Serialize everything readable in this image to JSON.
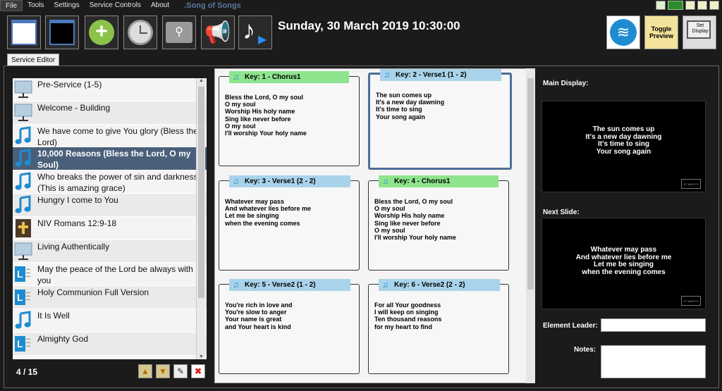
{
  "menu": {
    "items": [
      "File",
      "Tools",
      "Settings",
      "Service Controls",
      "About"
    ],
    "app_title": ".Song of Songs"
  },
  "toolbar": {
    "datetime": "Sunday, 30 March 2019 10:30:00",
    "toggle_preview_label": "Toggle Preview",
    "set_display_label": "Set Display"
  },
  "tab": {
    "label": "Service Editor"
  },
  "service_list": {
    "counter": "4 / 15",
    "items": [
      {
        "label": "Pre-Service (1-5)",
        "icon": "monitor-icon"
      },
      {
        "label": "Welcome - Building",
        "icon": "monitor-icon"
      },
      {
        "label": "We have come to give You glory  (Bless the Lord)",
        "icon": "music-note-icon"
      },
      {
        "label": "10,000 Reasons (Bless the Lord, O my Soul)",
        "icon": "music-note-icon",
        "selected": true
      },
      {
        "label": "Who breaks the power of sin and darkness (This is amazing grace)",
        "icon": "music-note-icon"
      },
      {
        "label": "Hungry I come to You",
        "icon": "music-note-icon"
      },
      {
        "label": "NIV Romans 12:9-18",
        "icon": "bible-icon"
      },
      {
        "label": "Living Authentically",
        "icon": "monitor-icon"
      },
      {
        "label": "May the peace of the Lord be always with you",
        "icon": "liturgy-icon"
      },
      {
        "label": "Holy Communion Full Version",
        "icon": "liturgy-icon"
      },
      {
        "label": "It Is Well",
        "icon": "music-note-icon"
      },
      {
        "label": "Almighty God",
        "icon": "liturgy-icon"
      }
    ]
  },
  "slides": [
    {
      "key": "Key: 1 - Chorus1",
      "type": "chorus",
      "lyrics": "Bless the Lord, O my soul\nO my soul\nWorship His holy name\nSing like never before\nO my soul\nI'll worship Your holy name"
    },
    {
      "key": "Key: 2 - Verse1 (1 - 2)",
      "type": "verse",
      "current": true,
      "lyrics": "The sun comes up\nIt's a new day dawning\nIt's time to sing\nYour song again"
    },
    {
      "key": "Key: 3 - Verse1 (2 - 2)",
      "type": "verse",
      "lyrics": "Whatever may pass\nAnd whatever lies before me\nLet me be singing\nwhen the evening comes"
    },
    {
      "key": "Key: 4 - Chorus1",
      "type": "chorus",
      "lyrics": "Bless the Lord, O my soul\nO my soul\nWorship His holy name\nSing like never before\nO my soul\nI'll worship Your holy name"
    },
    {
      "key": "Key: 5 - Verse2 (1 - 2)",
      "type": "verse",
      "lyrics": "You're rich in love and\nYou're slow to anger\nYour name is great\nand Your heart is kind"
    },
    {
      "key": "Key: 6 - Verse2 (2 - 2)",
      "type": "verse",
      "lyrics": "For all Your goodness\nI will keep on singing\nTen thousand reasons\n for my heart to find"
    }
  ],
  "right_panel": {
    "main_display_label": "Main Display:",
    "main_display_text": "The sun comes up\nIt's a new day dawning\nIt's time to sing\nYour song again",
    "next_slide_label": "Next Slide:",
    "next_slide_text": "Whatever may pass\nAnd whatever lies before me\nLet me be singing\nwhen the evening comes",
    "element_leader_label": "Element Leader:",
    "element_leader_value": "",
    "notes_label": "Notes:",
    "notes_value": ""
  }
}
